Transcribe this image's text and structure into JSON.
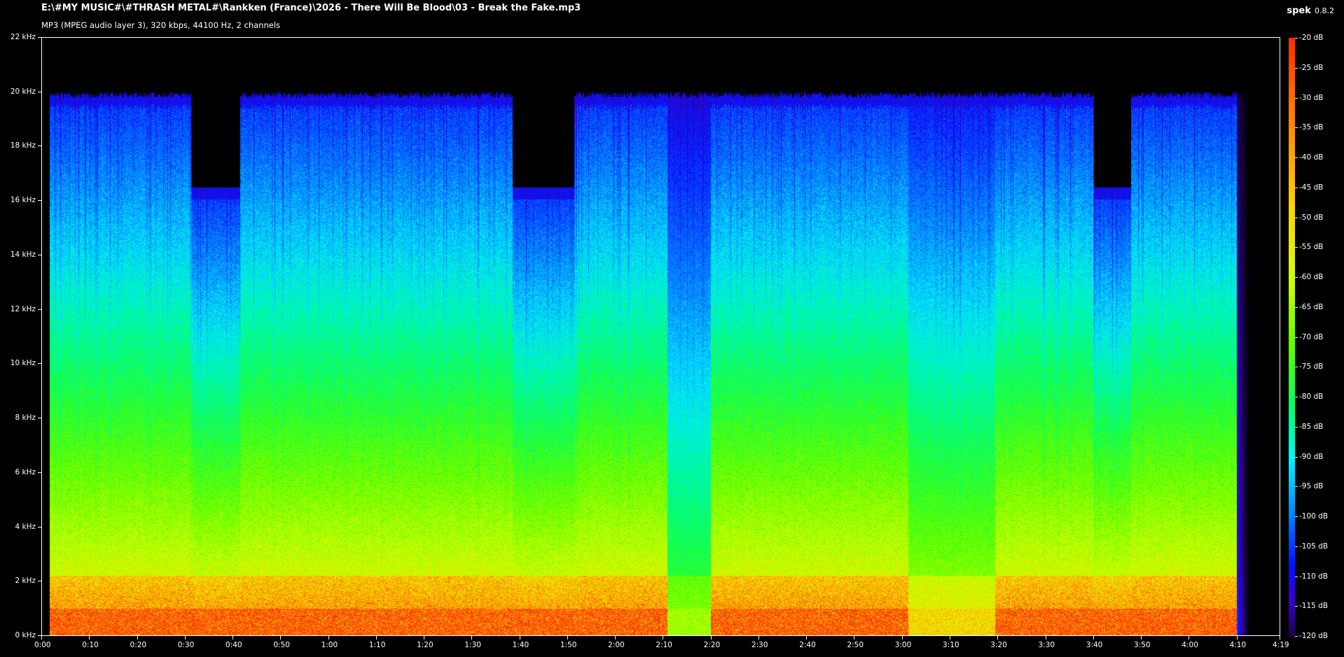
{
  "header": {
    "file_path": "E:\\#MY MUSIC#\\#THRASH METAL#\\Rankken (France)\\2026 - There Will Be Blood\\03 - Break the Fake.mp3",
    "file_info": "MP3 (MPEG audio layer 3), 320 kbps, 44100 Hz, 2 channels",
    "app_name": "spek",
    "app_version": "0.8.2"
  },
  "axes": {
    "y_labels": [
      "22 kHz",
      "20 kHz",
      "18 kHz",
      "16 kHz",
      "14 kHz",
      "12 kHz",
      "10 kHz",
      "8 kHz",
      "6 kHz",
      "4 kHz",
      "2 kHz",
      "0 kHz"
    ],
    "x_labels": [
      "0:00",
      "0:10",
      "0:20",
      "0:30",
      "0:40",
      "0:50",
      "1:00",
      "1:10",
      "1:20",
      "1:30",
      "1:40",
      "1:50",
      "2:00",
      "2:10",
      "2:20",
      "2:30",
      "2:40",
      "2:50",
      "3:00",
      "3:10",
      "3:20",
      "3:30",
      "3:40",
      "3:50",
      "4:00",
      "4:10",
      "4:19"
    ],
    "db_labels": [
      "-20 dB",
      "-25 dB",
      "-30 dB",
      "-35 dB",
      "-40 dB",
      "-45 dB",
      "-50 dB",
      "-55 dB",
      "-60 dB",
      "-65 dB",
      "-70 dB",
      "-75 dB",
      "-80 dB",
      "-85 dB",
      "-90 dB",
      "-95 dB",
      "-100 dB",
      "-105 dB",
      "-110 dB",
      "-115 dB",
      "-120 dB"
    ]
  },
  "colors": {
    "background": "#000000",
    "text": "#ffffff",
    "loud": "#ff2a00",
    "mid": "#59ff00",
    "quiet": "#0010ff"
  }
}
